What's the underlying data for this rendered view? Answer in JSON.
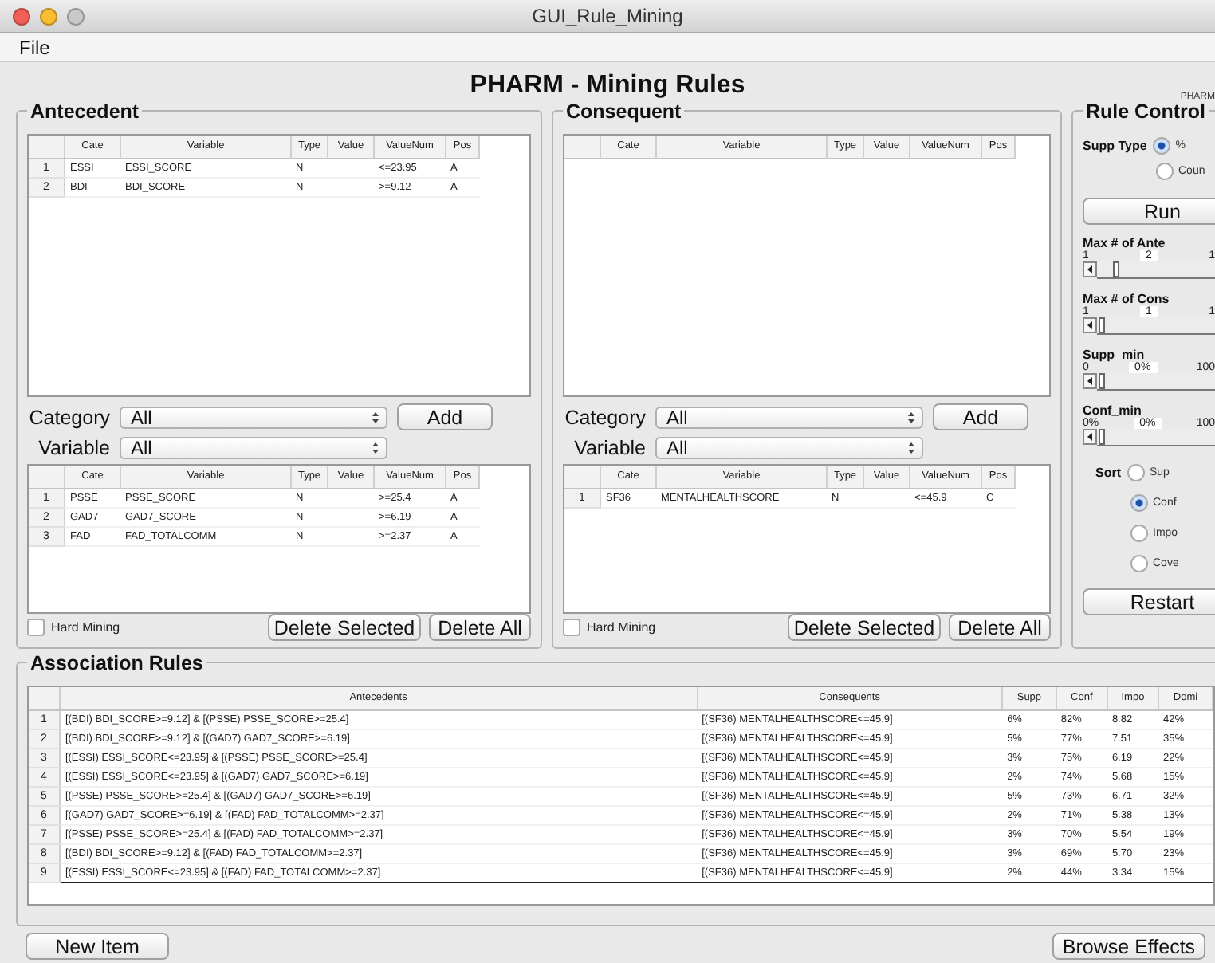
{
  "window": {
    "title": "GUI_Rule_Mining"
  },
  "menu": [
    "File"
  ],
  "heading": "PHARM - Mining Rules",
  "corner_label": "PHARM",
  "panels": [
    {
      "title": "Antecedent",
      "columns": [
        "Cate",
        "Variable",
        "Type",
        "Value",
        "ValueNum",
        "Pos"
      ],
      "rows": [
        {
          "num": "1",
          "cells": [
            "ESSI",
            "ESSI_SCORE",
            "N",
            "",
            "<=23.95",
            "A"
          ]
        },
        {
          "num": "2",
          "cells": [
            "BDI",
            "BDI_SCORE",
            "N",
            "",
            ">=9.12",
            "A"
          ]
        }
      ],
      "category": {
        "label": "Category",
        "value": "All"
      },
      "variable": {
        "label": "Variable",
        "value": "All"
      },
      "add": "Add",
      "selected_columns": [
        "Cate",
        "Variable",
        "Type",
        "Value",
        "ValueNum",
        "Pos"
      ],
      "selected_rows": [
        {
          "num": "1",
          "cells": [
            "PSSE",
            "PSSE_SCORE",
            "N",
            "",
            ">=25.4",
            "A"
          ]
        },
        {
          "num": "2",
          "cells": [
            "GAD7",
            "GAD7_SCORE",
            "N",
            "",
            ">=6.19",
            "A"
          ]
        },
        {
          "num": "3",
          "cells": [
            "FAD",
            "FAD_TOTALCOMM",
            "N",
            "",
            ">=2.37",
            "A"
          ]
        }
      ],
      "hard_mining": {
        "label": "Hard Mining",
        "checked": false
      },
      "buttons": [
        "Delete Selected",
        "Delete All"
      ]
    },
    {
      "title": "Consequent",
      "columns": [
        "Cate",
        "Variable",
        "Type",
        "Value",
        "ValueNum",
        "Pos"
      ],
      "category": {
        "label": "Category",
        "value": "All"
      },
      "variable": {
        "label": "Variable",
        "value": "All"
      },
      "add": "Add",
      "selected_columns": [
        "Cate",
        "Variable",
        "Type",
        "Value",
        "ValueNum",
        "Pos"
      ],
      "selected_rows": [
        {
          "num": "1",
          "cells": [
            "SF36",
            "MENTALHEALTHSCORE",
            "N",
            "",
            "<=45.9",
            "C"
          ]
        }
      ],
      "hard_mining": {
        "label": "Hard Mining",
        "checked": false
      },
      "buttons": [
        "Delete Selected",
        "Delete All"
      ]
    }
  ],
  "rule_control": {
    "title": "Rule Control",
    "supp_type": {
      "label": "Supp Type",
      "options": [
        {
          "label": "%",
          "selected": true
        },
        {
          "label": "Coun",
          "selected": false
        }
      ]
    },
    "run": "Run",
    "sliders": [
      {
        "label": "Max # of Ante",
        "min": "1",
        "value": "2",
        "max": "1",
        "level": 0.14
      },
      {
        "label": "Max # of Cons",
        "min": "1",
        "value": "1",
        "max": "1",
        "level": 0.02
      },
      {
        "label": "Supp_min",
        "min": "0",
        "value": "0%",
        "max": "100",
        "level": 0.02
      },
      {
        "label": "Conf_min",
        "min": "0%",
        "value": "0%",
        "max": "100",
        "level": 0.02
      }
    ],
    "sort": {
      "label": "Sort",
      "options": [
        {
          "label": "Sup",
          "selected": false
        },
        {
          "label": "Conf",
          "selected": true
        },
        {
          "label": "Impo",
          "selected": false
        },
        {
          "label": "Cove",
          "selected": false
        }
      ]
    },
    "restart": "Restart"
  },
  "association_rules": {
    "title": "Association Rules",
    "columns": [
      "Antecedents",
      "Consequents",
      "Supp",
      "Conf",
      "Impo",
      "Domi"
    ],
    "rows": [
      {
        "num": "1",
        "cells": [
          "[(BDI) BDI_SCORE>=9.12] & [(PSSE) PSSE_SCORE>=25.4]",
          "[(SF36) MENTALHEALTHSCORE<=45.9]",
          "6%",
          "82%",
          "8.82",
          "42%"
        ]
      },
      {
        "num": "2",
        "cells": [
          "[(BDI) BDI_SCORE>=9.12] & [(GAD7) GAD7_SCORE>=6.19]",
          "[(SF36) MENTALHEALTHSCORE<=45.9]",
          "5%",
          "77%",
          "7.51",
          "35%"
        ]
      },
      {
        "num": "3",
        "cells": [
          "[(ESSI) ESSI_SCORE<=23.95] & [(PSSE) PSSE_SCORE>=25.4]",
          "[(SF36) MENTALHEALTHSCORE<=45.9]",
          "3%",
          "75%",
          "6.19",
          "22%"
        ]
      },
      {
        "num": "4",
        "cells": [
          "[(ESSI) ESSI_SCORE<=23.95] & [(GAD7) GAD7_SCORE>=6.19]",
          "[(SF36) MENTALHEALTHSCORE<=45.9]",
          "2%",
          "74%",
          "5.68",
          "15%"
        ]
      },
      {
        "num": "5",
        "cells": [
          "[(PSSE) PSSE_SCORE>=25.4] & [(GAD7) GAD7_SCORE>=6.19]",
          "[(SF36) MENTALHEALTHSCORE<=45.9]",
          "5%",
          "73%",
          "6.71",
          "32%"
        ]
      },
      {
        "num": "6",
        "cells": [
          "[(GAD7) GAD7_SCORE>=6.19] & [(FAD) FAD_TOTALCOMM>=2.37]",
          "[(SF36) MENTALHEALTHSCORE<=45.9]",
          "2%",
          "71%",
          "5.38",
          "13%"
        ]
      },
      {
        "num": "7",
        "cells": [
          "[(PSSE) PSSE_SCORE>=25.4] & [(FAD) FAD_TOTALCOMM>=2.37]",
          "[(SF36) MENTALHEALTHSCORE<=45.9]",
          "3%",
          "70%",
          "5.54",
          "19%"
        ]
      },
      {
        "num": "8",
        "cells": [
          "[(BDI) BDI_SCORE>=9.12] & [(FAD) FAD_TOTALCOMM>=2.37]",
          "[(SF36) MENTALHEALTHSCORE<=45.9]",
          "3%",
          "69%",
          "5.70",
          "23%"
        ]
      },
      {
        "num": "9",
        "cells": [
          "[(ESSI) ESSI_SCORE<=23.95] & [(FAD) FAD_TOTALCOMM>=2.37]",
          "[(SF36) MENTALHEALTHSCORE<=45.9]",
          "2%",
          "44%",
          "3.34",
          "15%"
        ]
      }
    ]
  },
  "bottom_buttons": [
    "New Item",
    "Browse Effects"
  ]
}
